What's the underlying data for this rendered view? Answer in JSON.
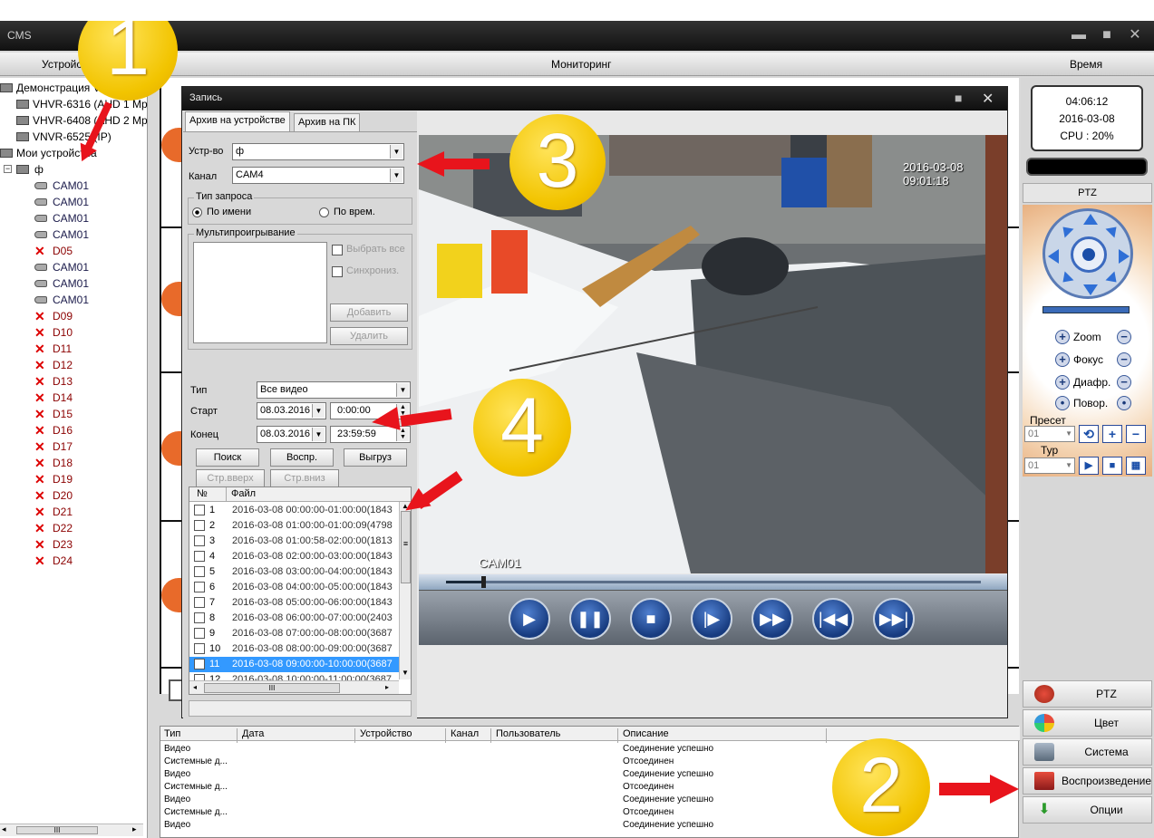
{
  "window": {
    "title": "CMS",
    "minimize": "▬",
    "maximize": "■",
    "close": "✕"
  },
  "menu": {
    "devices": "Устройство",
    "monitoring": "Мониторинг",
    "time": "Время"
  },
  "tree": {
    "group1": "Демонстрация V",
    "devices": [
      "VHVR-6316 (AHD 1 Mp",
      "VHVR-6408 (AHD 2 Mp",
      "VNVR-6525 (IP)"
    ],
    "group2": "Мои устройства",
    "root": "ф",
    "channels": [
      {
        "label": "CAM01",
        "on": true
      },
      {
        "label": "CAM01",
        "on": true
      },
      {
        "label": "CAM01",
        "on": true
      },
      {
        "label": "CAM01",
        "on": true
      },
      {
        "label": "D05",
        "on": false
      },
      {
        "label": "CAM01",
        "on": true
      },
      {
        "label": "CAM01",
        "on": true
      },
      {
        "label": "CAM01",
        "on": true
      },
      {
        "label": "D09",
        "on": false
      },
      {
        "label": "D10",
        "on": false
      },
      {
        "label": "D11",
        "on": false
      },
      {
        "label": "D12",
        "on": false
      },
      {
        "label": "D13",
        "on": false
      },
      {
        "label": "D14",
        "on": false
      },
      {
        "label": "D15",
        "on": false
      },
      {
        "label": "D16",
        "on": false
      },
      {
        "label": "D17",
        "on": false
      },
      {
        "label": "D18",
        "on": false
      },
      {
        "label": "D19",
        "on": false
      },
      {
        "label": "D20",
        "on": false
      },
      {
        "label": "D21",
        "on": false
      },
      {
        "label": "D22",
        "on": false
      },
      {
        "label": "D23",
        "on": false
      },
      {
        "label": "D24",
        "on": false
      }
    ],
    "scroll_thumb": "III"
  },
  "status": {
    "time": "04:06:12",
    "date": "2016-03-08",
    "cpu": "CPU : 20%"
  },
  "ptz": {
    "header": "PTZ",
    "zoom": "Zoom",
    "focus": "Фокус",
    "iris": "Диафр.",
    "rotate": "Повор.",
    "preset_label": "Пресет",
    "preset_value": "01",
    "tour_label": "Тур",
    "tour_value": "01"
  },
  "nav": {
    "ptz": "PTZ",
    "color": "Цвет",
    "system": "Система",
    "playback": "Воспроизведение",
    "options": "Опции"
  },
  "log": {
    "headers": [
      "Тип",
      "Дата",
      "Устройство",
      "Канал",
      "Пользователь",
      "Описание"
    ],
    "rows": [
      {
        "type": "Видео",
        "desc": "Соединение успешно"
      },
      {
        "type": "Системные д...",
        "desc": "Отсоединен"
      },
      {
        "type": "Видео",
        "desc": "Соединение успешно"
      },
      {
        "type": "Системные д...",
        "desc": "Отсоединен"
      },
      {
        "type": "Видео",
        "desc": "Соединение успешно"
      },
      {
        "type": "Системные д...",
        "desc": "Отсоединен"
      },
      {
        "type": "Видео",
        "desc": "Соединение успешно"
      }
    ]
  },
  "dialog": {
    "title": "Запись",
    "tab_device": "Архив на устройстве",
    "tab_pc": "Архив на ПК",
    "device_label": "Устр-во",
    "device_value": "ф",
    "channel_label": "Канал",
    "channel_value": "CAM4",
    "query_type": "Тип запроса",
    "by_name": "По имени",
    "by_time": "По врем.",
    "multiplay": "Мультипроигрывание",
    "select_all": "Выбрать все",
    "sync": "Синхрониз.",
    "add": "Добавить",
    "delete": "Удалить",
    "type_label": "Тип",
    "type_value": "Все видео",
    "start_label": "Старт",
    "start_date": "08.03.2016",
    "start_time": "0:00:00",
    "end_label": "Конец",
    "end_date": "08.03.2016",
    "end_time": "23:59:59",
    "search": "Поиск",
    "play": "Воспр.",
    "download": "Выгруз",
    "page_up": "Стр.вверх",
    "page_down": "Стр.вниз",
    "col_num": "№",
    "col_file": "Файл",
    "files": [
      {
        "n": "1",
        "f": "2016-03-08 00:00:00-01:00:00(1843",
        "checked": false
      },
      {
        "n": "2",
        "f": "2016-03-08 01:00:00-01:00:09(4798",
        "checked": false
      },
      {
        "n": "3",
        "f": "2016-03-08 01:00:58-02:00:00(1813",
        "checked": false
      },
      {
        "n": "4",
        "f": "2016-03-08 02:00:00-03:00:00(1843",
        "checked": false
      },
      {
        "n": "5",
        "f": "2016-03-08 03:00:00-04:00:00(1843",
        "checked": false
      },
      {
        "n": "6",
        "f": "2016-03-08 04:00:00-05:00:00(1843",
        "checked": false
      },
      {
        "n": "7",
        "f": "2016-03-08 05:00:00-06:00:00(1843",
        "checked": false
      },
      {
        "n": "8",
        "f": "2016-03-08 06:00:00-07:00:00(2403",
        "checked": false
      },
      {
        "n": "9",
        "f": "2016-03-08 07:00:00-08:00:00(3687",
        "checked": false
      },
      {
        "n": "10",
        "f": "2016-03-08 08:00:00-09:00:00(3687",
        "checked": false
      },
      {
        "n": "11",
        "f": "2016-03-08 09:00:00-10:00:00(3687",
        "checked": true
      },
      {
        "n": "12",
        "f": "2016-03-08 10:00:00-11:00:00(3687",
        "checked": false
      }
    ],
    "hscroll_thumb": "III",
    "video_timestamp": "2016-03-08 09:01:18",
    "video_cam": "CAM01",
    "playback_position": 0.07
  },
  "annotations": {
    "n1": "1",
    "n2": "2",
    "n3": "3",
    "n4": "4"
  },
  "colors": {
    "accent_yellow": "#f2c400",
    "arrow_red": "#e8141c",
    "selection_blue": "#3399ff"
  }
}
